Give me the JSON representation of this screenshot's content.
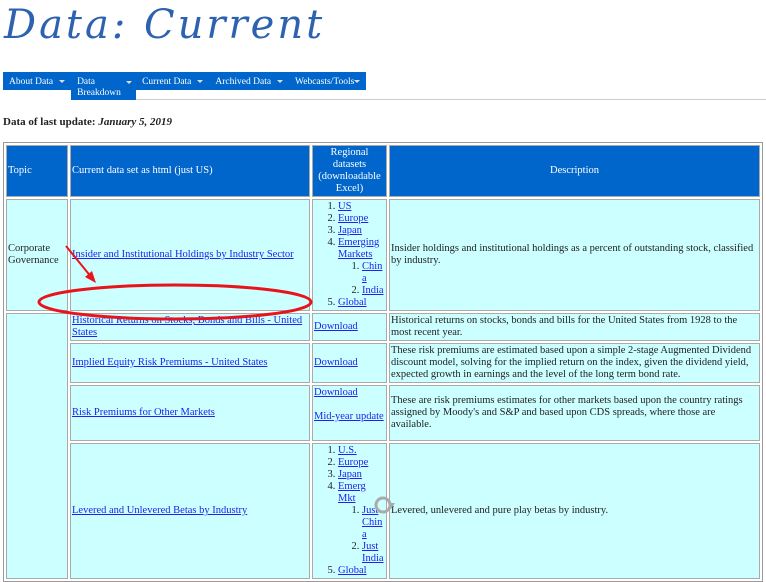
{
  "header": {
    "title": "Data: Current"
  },
  "nav": {
    "items": [
      {
        "label": "About Data"
      },
      {
        "label": "Data Breakdown"
      },
      {
        "label": "Current Data"
      },
      {
        "label": "Archived Data"
      },
      {
        "label": "Webcasts/Tools"
      }
    ]
  },
  "update": {
    "label": "Data of last update:",
    "date": "January 5, 2019"
  },
  "table": {
    "headers": {
      "topic": "Topic",
      "current": "Current data set as html (just US)",
      "regional": "Regional datasets (downloadable Excel)",
      "description": "Description"
    },
    "rows": [
      {
        "topic": "Corporate Governance",
        "current": "Insider and Institutional Holdings by Industry Sector",
        "regional": [
          "US",
          "Europe",
          "Japan",
          "Emerging Markets",
          "Global"
        ],
        "regional_sub": [
          "China",
          "India"
        ],
        "description": "Insider holdings and institutional holdings as a percent of outstanding stock, classified by industry."
      },
      {
        "topic": "",
        "current": "Historical Returns on Stocks, Bonds and Bills - United States",
        "regional": [
          "Download"
        ],
        "description": "Historical returns on stocks, bonds and bills for the United States from 1928 to the most recent year."
      },
      {
        "topic": "",
        "current": "Implied Equity Risk Premiums - United States",
        "regional": [
          "Download"
        ],
        "description": "These risk premiums are estimated based upon a simple 2-stage Augmented Dividend discount model, solving for the implied return on the index, given the dividend yield, expected growth in earnings and the level of the long term bond rate."
      },
      {
        "topic": "",
        "current": "Risk Premiums for Other Markets",
        "regional": [
          "Download",
          "Mid-year update"
        ],
        "description": "These are risk premiums estimates for other markets based upon the country ratings assigned by Moody's and S&P and based upon CDS spreads, where those are available."
      },
      {
        "topic": "",
        "current": "Levered and Unlevered Betas by Industry",
        "regional": [
          "U.S.",
          "Europe",
          "Japan",
          "Emerg Mkt",
          "Global"
        ],
        "regional_sub": [
          "Just China",
          "Just India"
        ],
        "description": "Levered, unlevered and pure play betas by industry."
      }
    ]
  },
  "annotation": {
    "color": "#e8141c"
  }
}
